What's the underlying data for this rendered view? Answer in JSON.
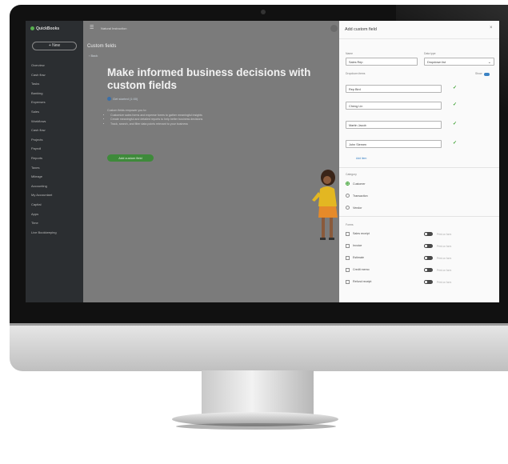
{
  "app": {
    "logo_text": "QuickBooks",
    "company_name": "Natural Instruction",
    "new_button": "+ New"
  },
  "sidebar": {
    "items": [
      "Overview",
      "Cash flow",
      "Tasks",
      "Banking",
      "Expenses",
      "Sales",
      "Workflows",
      "Cash flow",
      "Projects",
      "Payroll",
      "Reports",
      "Taxes",
      "Mileage",
      "Accounting",
      "My Accountant",
      "Capital",
      "Apps",
      "Time",
      "Live Bookkeeping"
    ]
  },
  "main": {
    "page_title": "Custom fields",
    "back_link": "‹ Back",
    "headline": "Make informed business decisions with custom fields",
    "video_link": "Get started (1:00)",
    "description": "Custom fields empower you to:",
    "bullets": [
      "Customize sales forms and expense forms to gather meaningful insights",
      "Create meaningful and detailed reports to help better business decisions",
      "Track, search, and filter data points relevant to your business"
    ],
    "add_button": "Add custom field"
  },
  "panel": {
    "title": "Add custom field",
    "close": "×",
    "name_label": "Name",
    "name_value": "Sales Rep",
    "type_label": "Data type",
    "type_value": "Dropdown list",
    "options_label": "Dropdown items",
    "show_label": "Show",
    "options": [
      "Rep Bird",
      "Cheng Lin",
      "Martin Jacob",
      "John Siemen"
    ],
    "add_item": "Add item",
    "category_label": "Category",
    "categories": [
      {
        "label": "Customer",
        "selected": true
      },
      {
        "label": "Transaction",
        "selected": false
      },
      {
        "label": "Vendor",
        "selected": false
      }
    ],
    "forms_label": "Forms",
    "forms": [
      "Sales receipt",
      "Invoice",
      "Estimate",
      "Credit memo",
      "Refund receipt"
    ],
    "print_label": "Print on form",
    "colors": {
      "accent_green": "#39a02f",
      "toggle_blue": "#3b82c4",
      "sidebar": "#2b2e31"
    }
  }
}
